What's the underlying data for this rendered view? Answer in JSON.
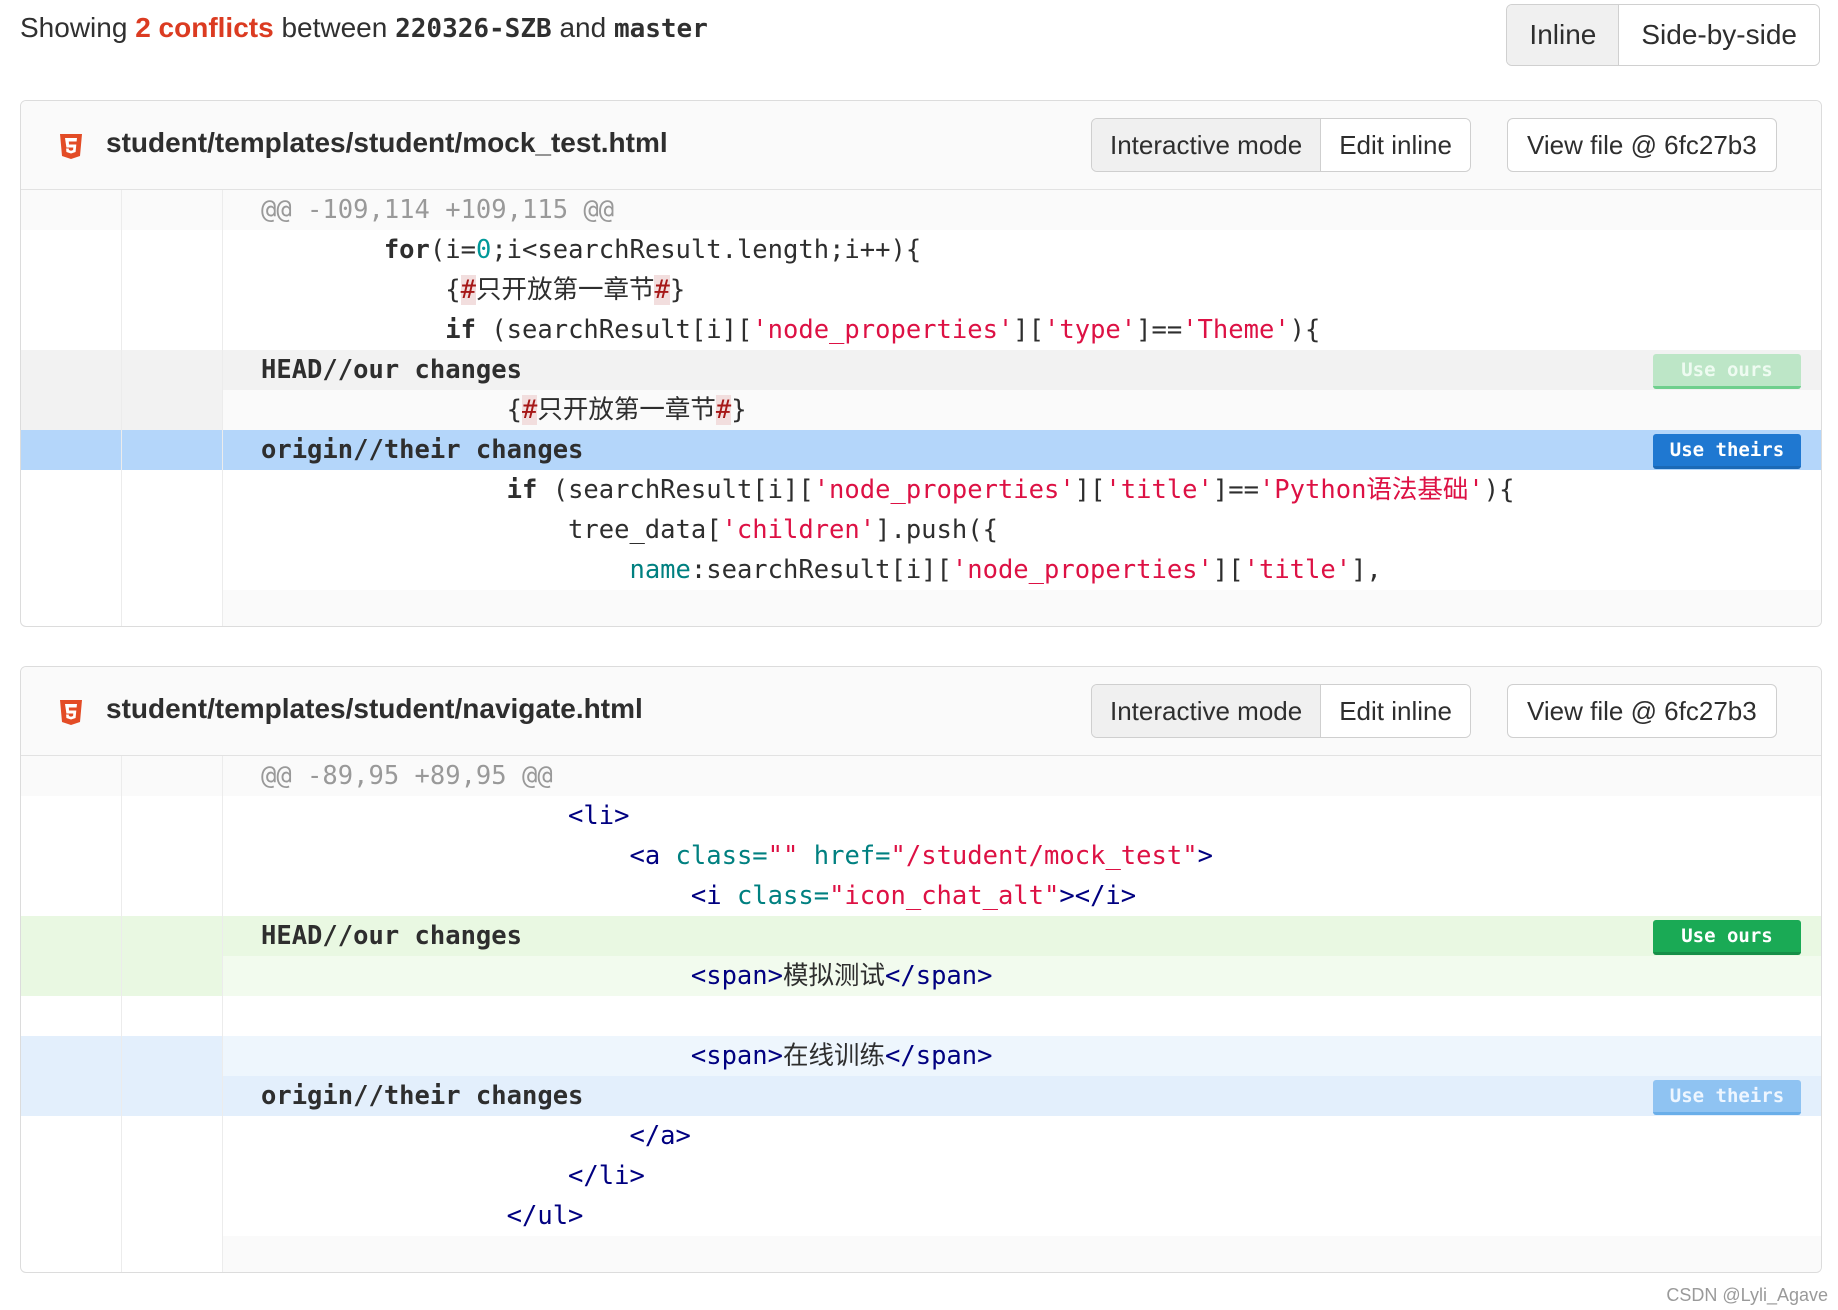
{
  "summary": {
    "prefix": "Showing",
    "conflicts": "2 conflicts",
    "between": "between",
    "source_branch": "220326-SZB",
    "and": "and",
    "target_branch": "master"
  },
  "view_toggle": {
    "inline": "Inline",
    "side_by_side": "Side-by-side"
  },
  "file_buttons": {
    "interactive_mode": "Interactive mode",
    "edit_inline": "Edit inline",
    "view_file": "View file @ 6fc27b3"
  },
  "conflict_buttons": {
    "use_ours": "Use ours",
    "use_theirs": "Use theirs"
  },
  "files": [
    {
      "path": "student/templates/student/mock_test.html",
      "hunk_header": "@@ -109,114 +109,115 @@",
      "ours_marker": "HEAD//our changes",
      "theirs_marker": "origin//their changes"
    },
    {
      "path": "student/templates/student/navigate.html",
      "hunk_header": "@@ -89,95 +89,95 @@",
      "ours_marker": "HEAD//our changes",
      "theirs_marker": "origin//their changes"
    }
  ],
  "colors": {
    "conflict_count": "#db3b21",
    "use_ours": "#1aaa55",
    "use_theirs": "#1f78d1",
    "string": "#dd1144",
    "tag": "#000080"
  },
  "watermark": "CSDN @Lyli_Agave"
}
